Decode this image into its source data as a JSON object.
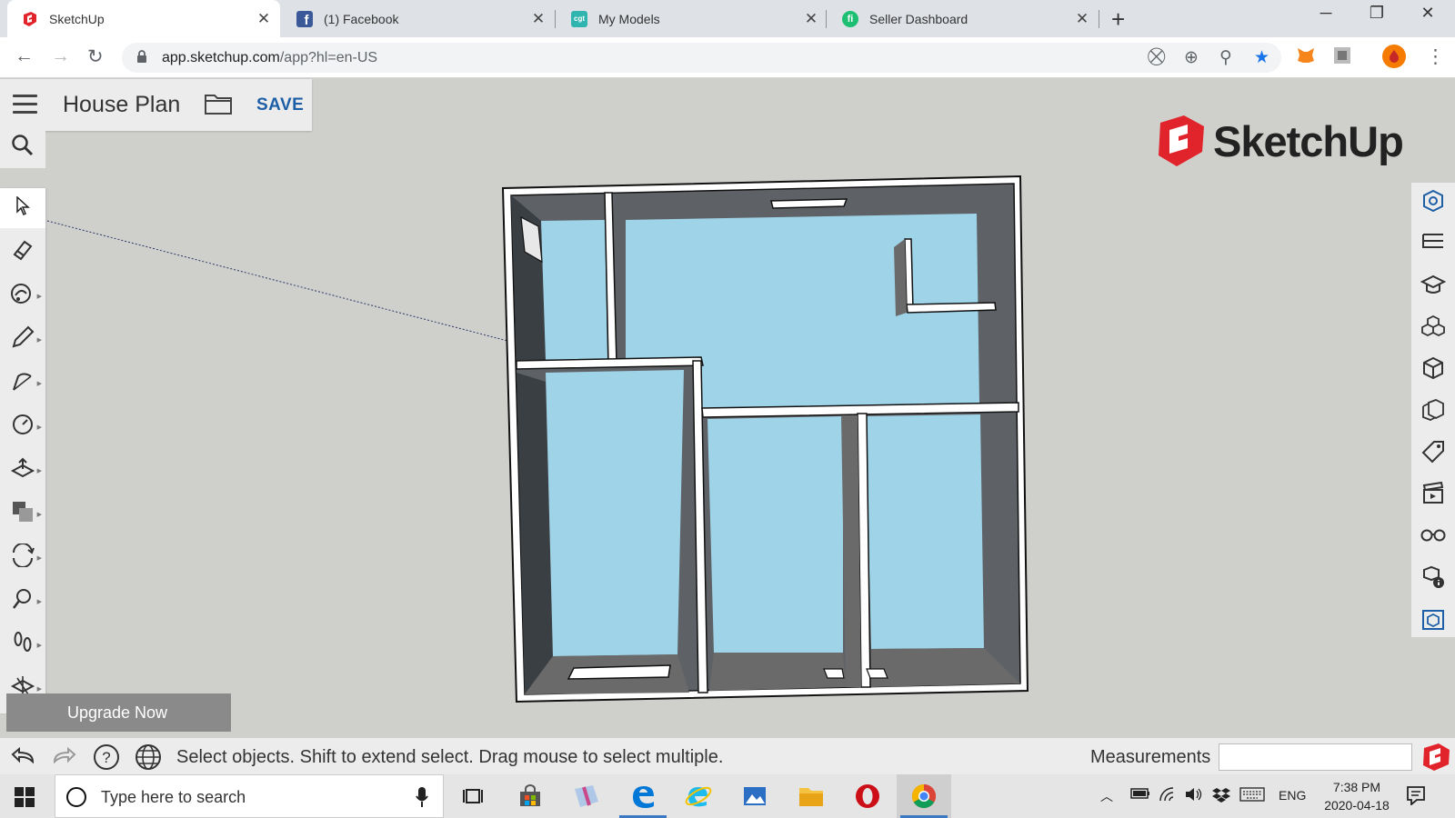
{
  "browser": {
    "tabs": [
      {
        "title": "SketchUp",
        "active": true
      },
      {
        "title": "(1) Facebook",
        "active": false
      },
      {
        "title": "My Models",
        "active": false
      },
      {
        "title": "Seller Dashboard",
        "active": false
      }
    ],
    "url_host": "app.sketchup.com",
    "url_path": "/app?hl=en-US"
  },
  "app": {
    "project_name": "House Plan",
    "save_label": "SAVE",
    "logo_text": "SketchUp",
    "upgrade_label": "Upgrade Now",
    "status_text": "Select objects. Shift to extend select. Drag mouse to select multiple.",
    "measurements_label": "Measurements",
    "measurements_value": "",
    "left_tools": [
      "select-tool",
      "eraser-tool",
      "paint-tool",
      "pencil-tool",
      "arc-tool",
      "tape-measure-tool",
      "push-pull-tool",
      "offset-tool",
      "orbit-tool",
      "position-camera-tool",
      "walk-tool",
      "section-plane-tool"
    ],
    "right_tools": [
      "entity-info-panel",
      "outliner-panel",
      "instructor-panel",
      "components-panel",
      "materials-panel",
      "styles-panel",
      "tags-panel",
      "scenes-panel",
      "display-panel",
      "model-info-panel",
      "export-panel"
    ]
  },
  "taskbar": {
    "search_placeholder": "Type here to search",
    "language": "ENG",
    "time": "7:38 PM",
    "date": "2020-04-18"
  },
  "colors": {
    "floor": "#9fd3e8",
    "wall_top": "#ffffff",
    "wall_side": "#6a6a6a",
    "wall_dark": "#3e4348",
    "brand_red": "#e1242b",
    "save_blue": "#1d5fa6"
  }
}
